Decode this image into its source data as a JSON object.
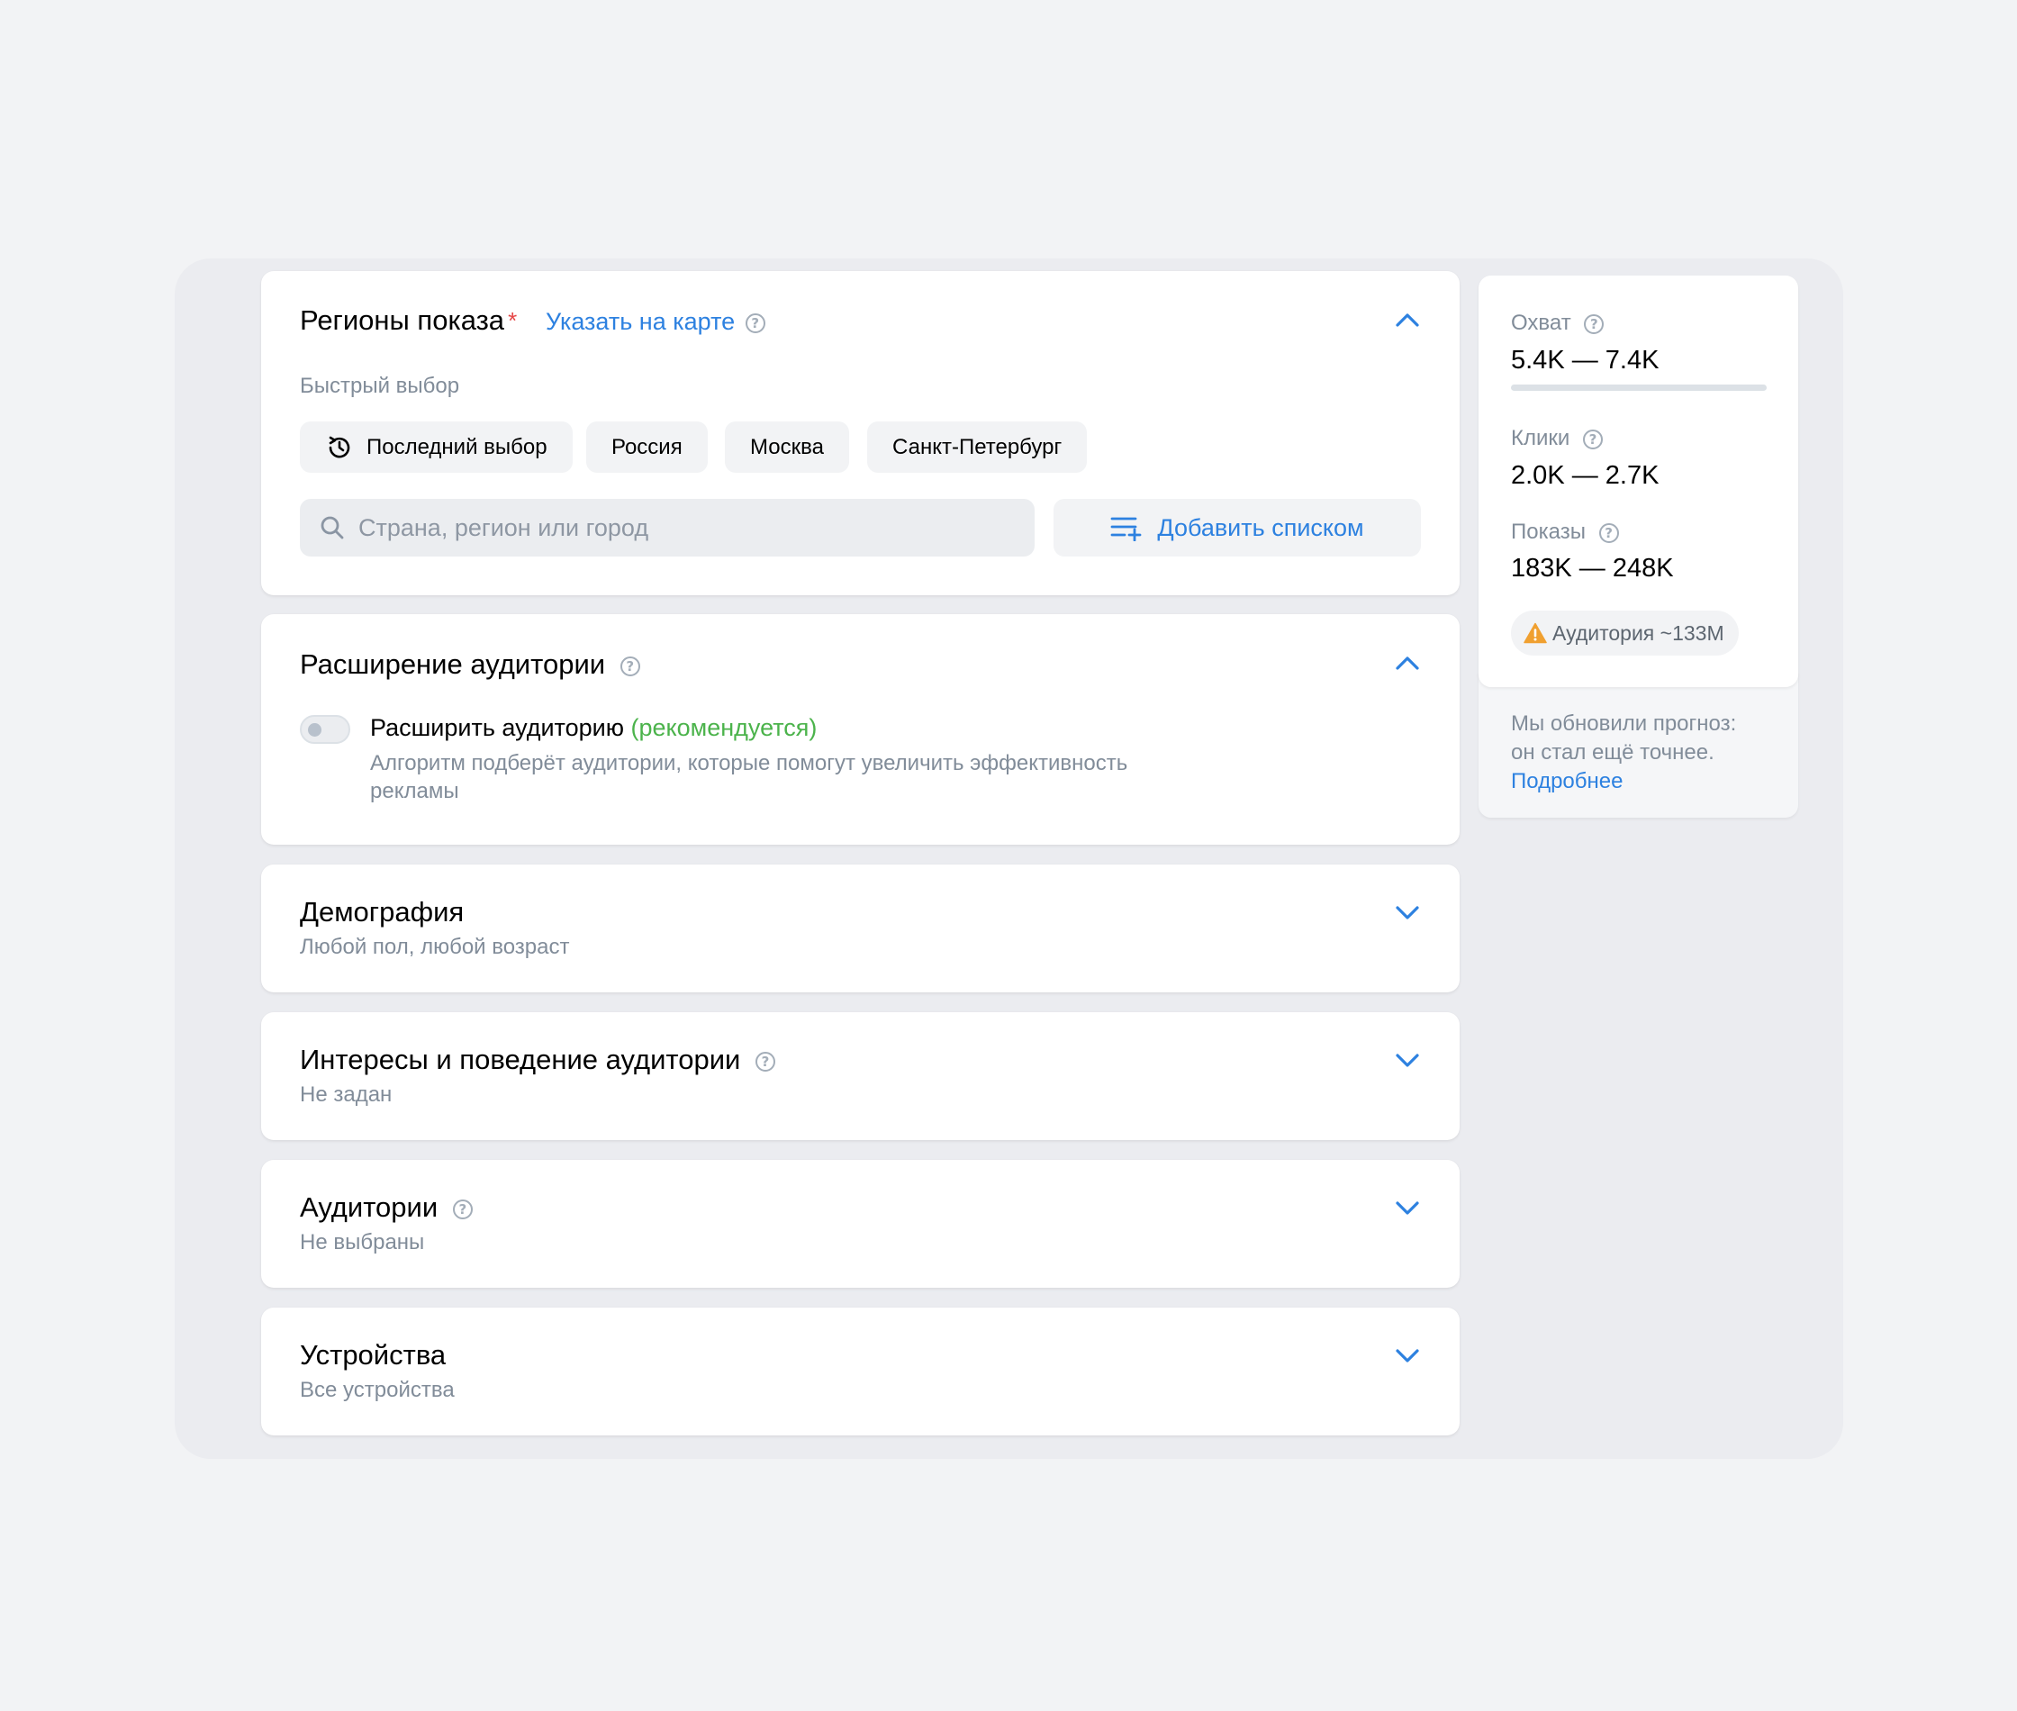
{
  "regions": {
    "title": "Регионы показа",
    "required_mark": "*",
    "map_link": "Указать на карте",
    "quick_label": "Быстрый выбор",
    "chips": [
      "Последний выбор",
      "Россия",
      "Москва",
      "Санкт-Петербург"
    ],
    "search_placeholder": "Страна, регион или город",
    "add_list_label": "Добавить списком"
  },
  "expansion": {
    "title": "Расширение аудитории",
    "toggle_label": "Расширить аудиторию",
    "recommended": "(рекомендуется)",
    "description_line1": "Алгоритм подберёт аудитории, которые помогут увеличить эффективность",
    "description_line2": "рекламы",
    "toggle_on": false
  },
  "demography": {
    "title": "Демография",
    "summary": "Любой пол, любой возраст"
  },
  "interests": {
    "title": "Интересы и поведение аудитории",
    "summary": "Не задан"
  },
  "audiences": {
    "title": "Аудитории",
    "summary": "Не выбраны"
  },
  "devices": {
    "title": "Устройства",
    "summary": "Все устройства"
  },
  "forecast": {
    "reach_label": "Охват",
    "reach_value": "5.4K — 7.4K",
    "clicks_label": "Клики",
    "clicks_value": "2.0K — 2.7K",
    "impressions_label": "Показы",
    "impressions_value": "183K — 248K",
    "audience_badge": "Аудитория ~133M",
    "note_line1": "Мы обновили прогноз:",
    "note_line2": "он стал ещё точнее.",
    "note_link": "Подробнее"
  },
  "colors": {
    "accent": "#2d81e0",
    "required": "#e64646",
    "recommended": "#4bb34b",
    "warning": "#f0a030",
    "secondary_text": "#818c99"
  }
}
